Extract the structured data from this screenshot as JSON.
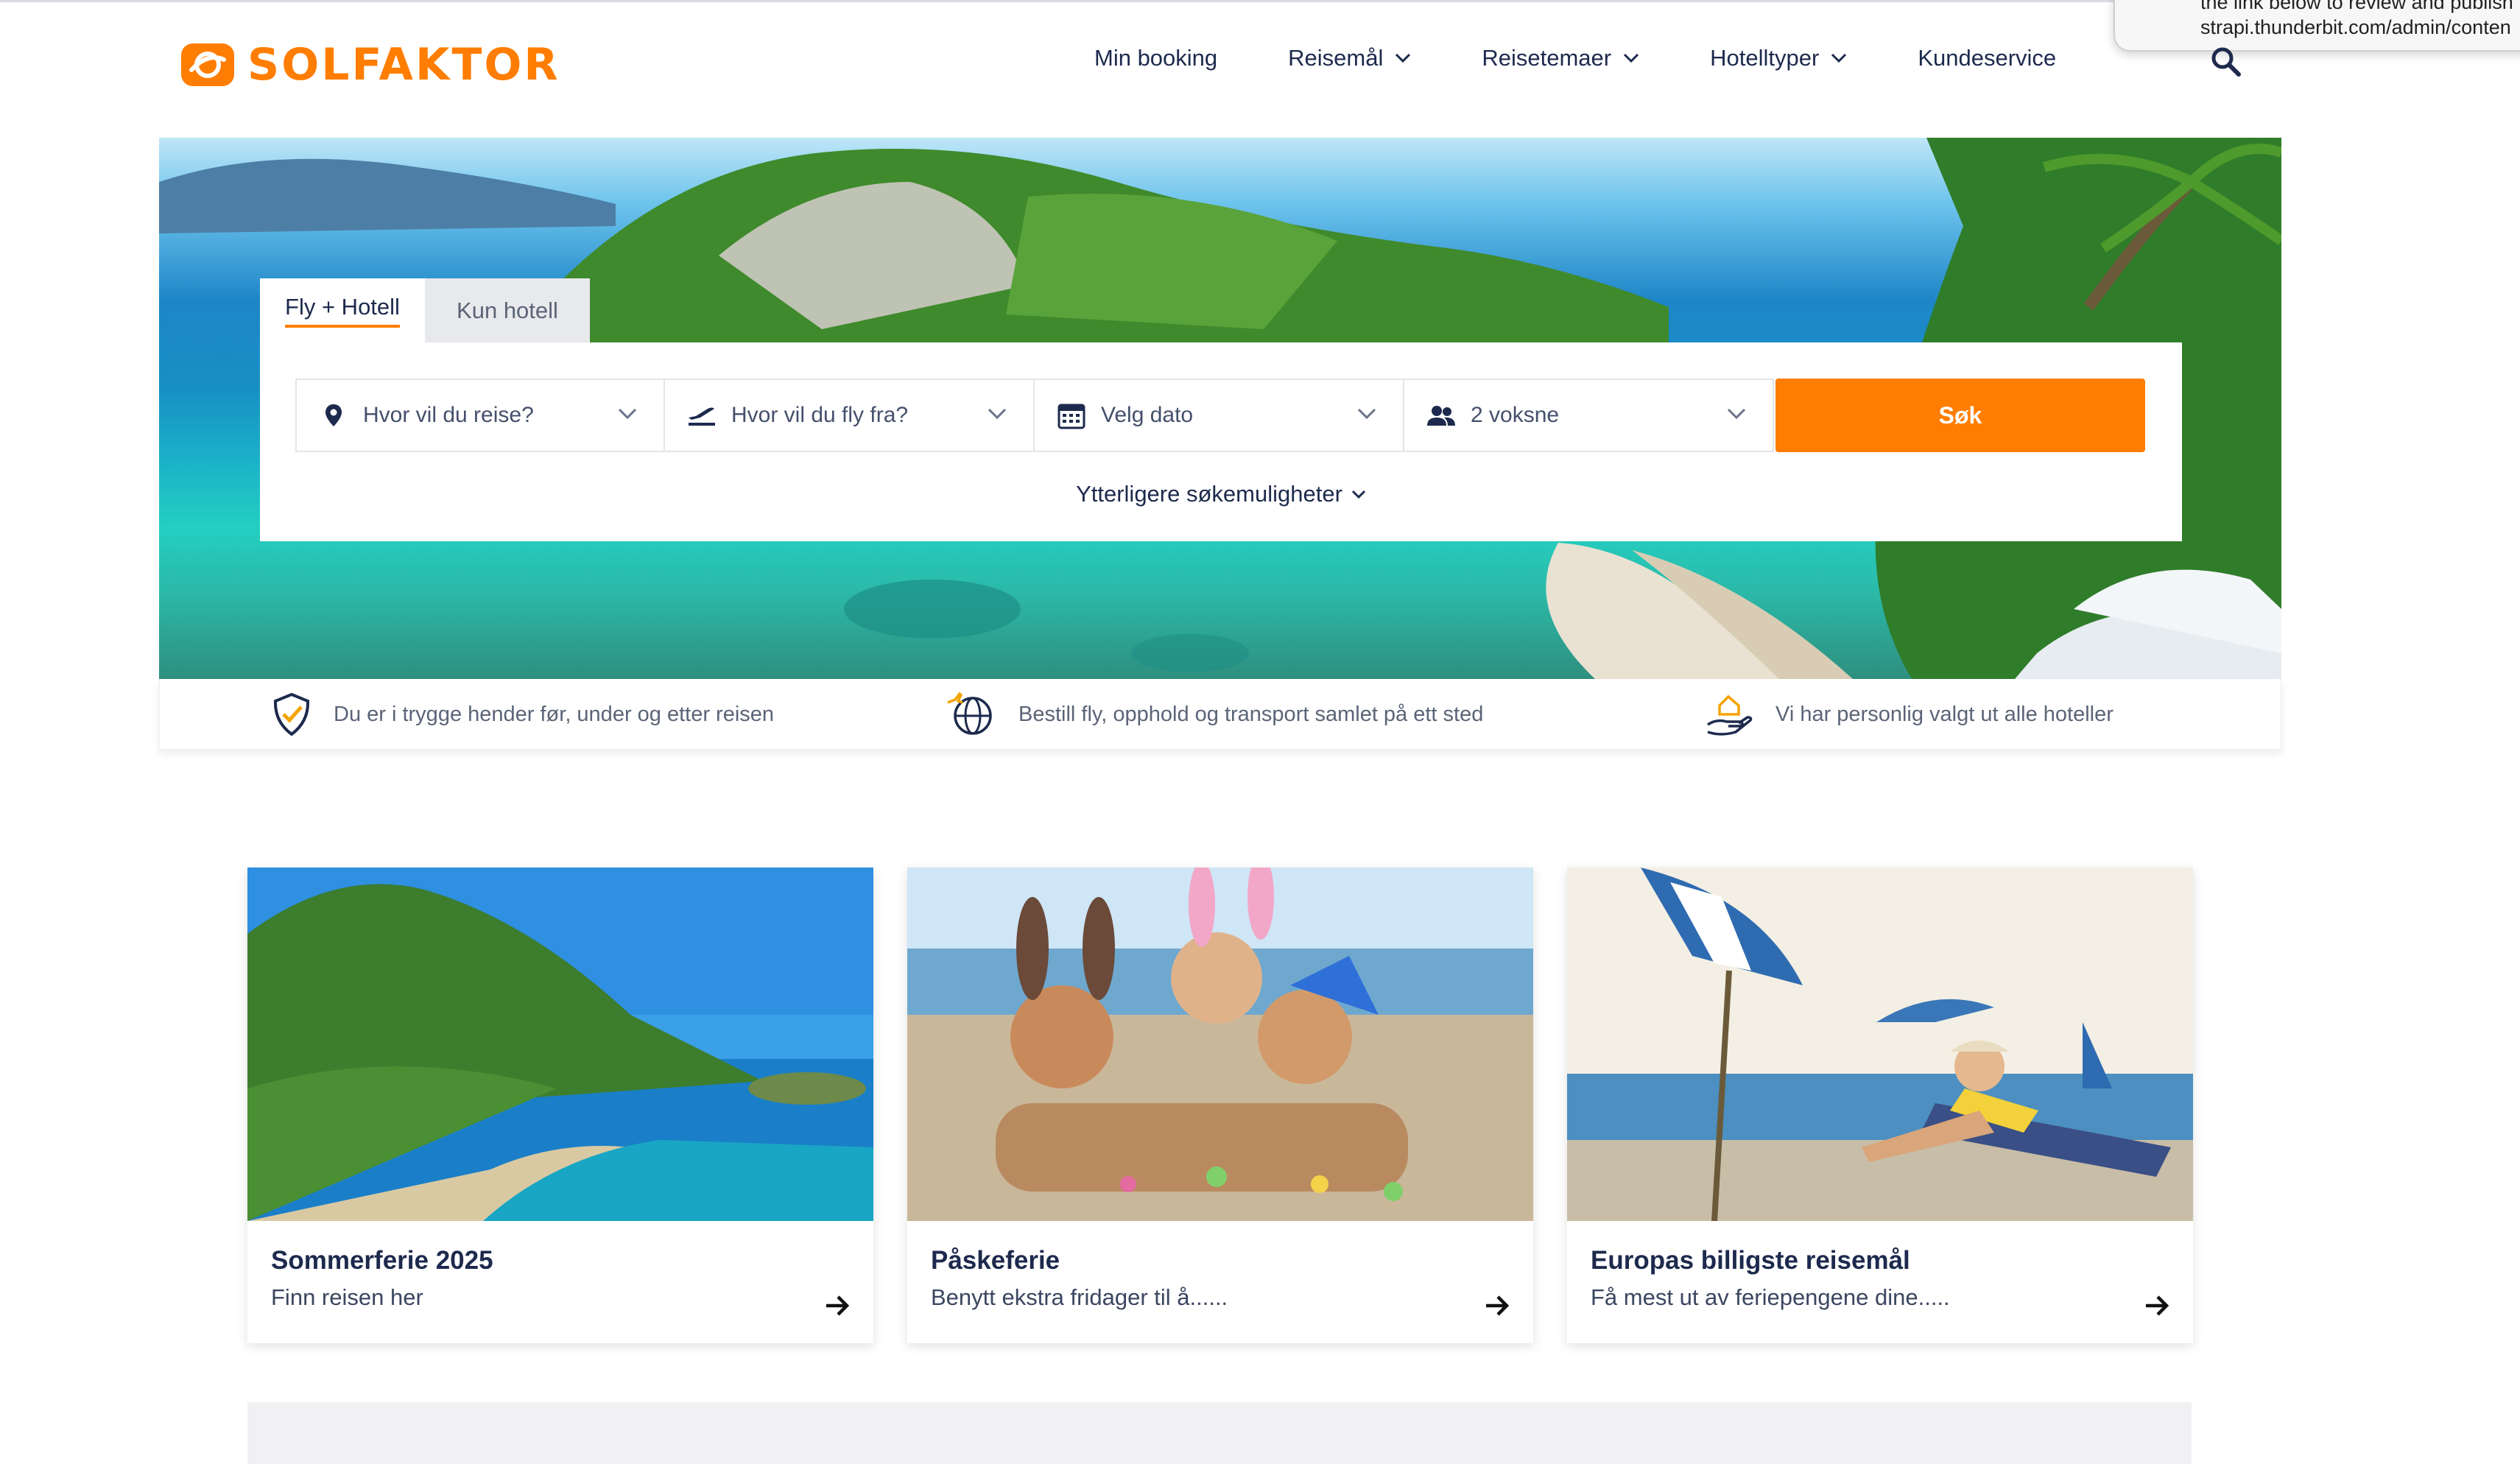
{
  "brand": {
    "name": "SOLFAKTOR",
    "color": "#ff7d00"
  },
  "nav": {
    "items": [
      {
        "label": "Min booking",
        "dropdown": false
      },
      {
        "label": "Reisemål",
        "dropdown": true
      },
      {
        "label": "Reisetemaer",
        "dropdown": true
      },
      {
        "label": "Hotelltyper",
        "dropdown": true
      },
      {
        "label": "Kundeservice",
        "dropdown": false
      }
    ],
    "search_icon": "search-icon"
  },
  "popup": {
    "line1": "the link below to review and publish",
    "line2": "strapi.thunderbit.com/admin/conten"
  },
  "search": {
    "tabs": [
      {
        "label": "Fly + Hotell",
        "active": true
      },
      {
        "label": "Kun hotell",
        "active": false
      }
    ],
    "fields": [
      {
        "icon": "location-pin-icon",
        "placeholder": "Hvor vil du reise?"
      },
      {
        "icon": "plane-departure-icon",
        "placeholder": "Hvor vil du fly fra?"
      },
      {
        "icon": "calendar-icon",
        "placeholder": "Velg dato"
      },
      {
        "icon": "people-icon",
        "value": "2 voksne"
      }
    ],
    "submit_label": "Søk",
    "more_options": "Ytterligere søkemuligheter",
    "accent": "#ff7d00"
  },
  "trust": [
    {
      "icon": "shield-check-icon",
      "text": "Du er i trygge hender før, under og etter reisen"
    },
    {
      "icon": "globe-plane-icon",
      "text": "Bestill fly, opphold og transport samlet på ett sted"
    },
    {
      "icon": "hand-house-icon",
      "text": "Vi har personlig valgt ut alle hoteller"
    }
  ],
  "cards": [
    {
      "title": "Sommerferie 2025",
      "subtitle": "Finn reisen her"
    },
    {
      "title": "Påskeferie",
      "subtitle": "Benytt ekstra fridager til å......"
    },
    {
      "title": "Europas billigste reisemål",
      "subtitle": "Få mest ut av feriepengene dine....."
    }
  ]
}
